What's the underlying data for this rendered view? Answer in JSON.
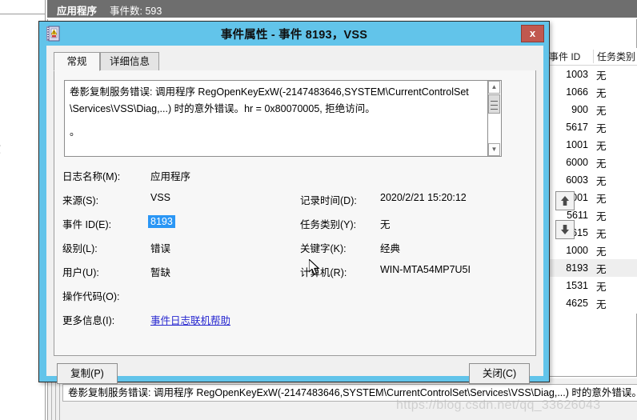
{
  "background": {
    "tree_label_partial": "志",
    "header": {
      "log_name": "应用程序",
      "event_count_label": "事件数: 593"
    },
    "list": {
      "columns": [
        "事件 ID",
        "任务类别"
      ],
      "rows": [
        {
          "event_id": "1003",
          "task_category": "无",
          "selected": false
        },
        {
          "event_id": "1066",
          "task_category": "无",
          "selected": false
        },
        {
          "event_id": "900",
          "task_category": "无",
          "selected": false
        },
        {
          "event_id": "5617",
          "task_category": "无",
          "selected": false
        },
        {
          "event_id": "1001",
          "task_category": "无",
          "selected": false
        },
        {
          "event_id": "6000",
          "task_category": "无",
          "selected": false
        },
        {
          "event_id": "6003",
          "task_category": "无",
          "selected": false
        },
        {
          "event_id": "1001",
          "task_category": "无",
          "selected": false
        },
        {
          "event_id": "5611",
          "task_category": "无",
          "selected": false
        },
        {
          "event_id": "5615",
          "task_category": "无",
          "selected": false
        },
        {
          "event_id": "1000",
          "task_category": "无",
          "selected": false
        },
        {
          "event_id": "8193",
          "task_category": "无",
          "selected": true
        },
        {
          "event_id": "1531",
          "task_category": "无",
          "selected": false
        },
        {
          "event_id": "4625",
          "task_category": "无",
          "selected": false
        }
      ]
    },
    "preview_text": "卷影复制服务错误: 调用程序 RegOpenKeyExW(-2147483646,SYSTEM\\CurrentControlSet\\Services\\VSS\\Diag,...) 时的意外错误。",
    "watermark": "https://blog.csdn.net/qq_33626043"
  },
  "dialog": {
    "title": "事件属性 - 事件 8193，VSS",
    "close_glyph": "x",
    "tabs": [
      {
        "label": "常规",
        "active": true
      },
      {
        "label": "详细信息",
        "active": false
      }
    ],
    "message": {
      "line1": "卷影复制服务错误: 调用程序 RegOpenKeyExW(-2147483646,SYSTEM\\CurrentControlSet",
      "line2": "\\Services\\VSS\\Diag,...) 时的意外错误。hr = 0x80070005, 拒绝访问。",
      "line3": "。"
    },
    "fields": {
      "log_name_label": "日志名称(M):",
      "log_name_value": "应用程序",
      "source_label": "来源(S):",
      "source_value": "VSS",
      "event_id_label": "事件 ID(E):",
      "event_id_value": "8193",
      "level_label": "级别(L):",
      "level_value": "错误",
      "user_label": "用户(U):",
      "user_value": "暂缺",
      "opcode_label": "操作代码(O):",
      "opcode_value": "",
      "more_info_label": "更多信息(I):",
      "more_info_link": "事件日志联机帮助",
      "logged_label": "记录时间(D):",
      "logged_value": "2020/2/21 15:20:12",
      "task_category_label": "任务类别(Y):",
      "task_category_value": "无",
      "keywords_label": "关键字(K):",
      "keywords_value": "经典",
      "computer_label": "计算机(R):",
      "computer_value": "WIN-MTA54MP7U5I"
    },
    "buttons": {
      "copy": "复制(P)",
      "close": "关闭(C)"
    },
    "nav": {
      "up_icon": "arrow-up-icon",
      "down_icon": "arrow-down-icon"
    }
  },
  "colors": {
    "dialog_frame": "#62c4ea",
    "close_button": "#c1584f",
    "selection_blue": "#2a96f5",
    "link_blue": "#2727d0",
    "header_gray": "#6e6e6e"
  }
}
